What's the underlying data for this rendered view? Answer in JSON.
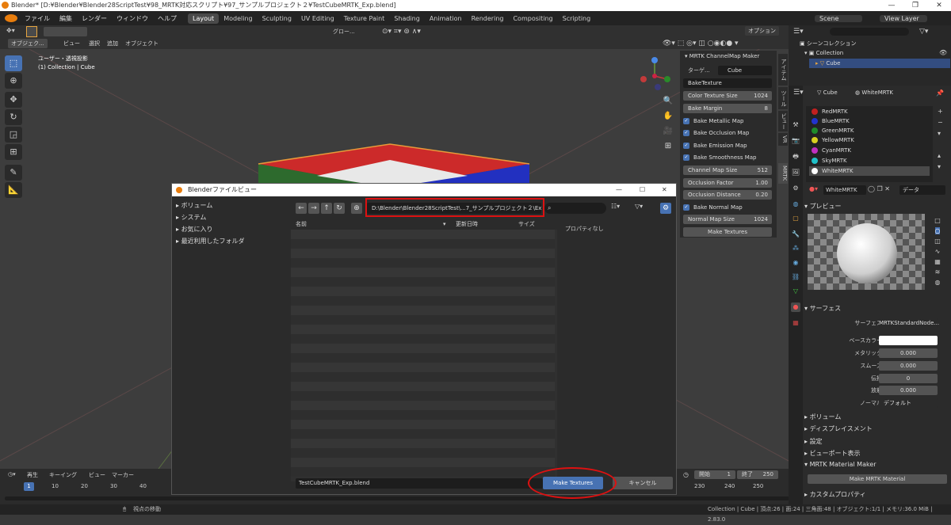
{
  "window": {
    "title": "Blender* [D:¥Blender¥Blender28ScriptTest¥98_MRTK対応スクリプト¥97_サンプルプロジェクト２¥TestCubeMRTK_Exp.blend]"
  },
  "menu": [
    "ファイル",
    "編集",
    "レンダー",
    "ウィンドウ",
    "ヘルプ"
  ],
  "workspaces": [
    "Layout",
    "Modeling",
    "Sculpting",
    "UV Editing",
    "Texture Paint",
    "Shading",
    "Animation",
    "Rendering",
    "Compositing",
    "Scripting"
  ],
  "scene": {
    "label": "Scene",
    "view_layer": "View Layer"
  },
  "viewport": {
    "orientation": "グロー...",
    "menus": [
      "オブジェク...",
      "ビュー",
      "選択",
      "追加",
      "オブジェクト"
    ],
    "view_name": "ユーザー・透視投影",
    "collection_info": "(1) Collection | Cube",
    "options": "オプション"
  },
  "npanel": {
    "title": "MRTK ChannelMap Maker",
    "target_label": "ターゲ...",
    "target_value": "Cube",
    "bake_name": "BakeTexture",
    "color_texture_size": {
      "label": "Color Texture Size",
      "value": "1024"
    },
    "bake_margin": {
      "label": "Bake Margin",
      "value": "8"
    },
    "checks": [
      "Bake Metallic Map",
      "Bake Occlusion Map",
      "Bake Emission Map",
      "Bake Smoothness Map"
    ],
    "channel_map_size": {
      "label": "Channel Map Size",
      "value": "512"
    },
    "occlusion_factor": {
      "label": "Occlusion Factor",
      "value": "1.00"
    },
    "occlusion_distance": {
      "label": "Occlusion Distance",
      "value": "0.20"
    },
    "normal_check": "Bake Normal Map",
    "normal_map_size": {
      "label": "Normal Map Size",
      "value": "1024"
    },
    "make_textures": "Make Textures",
    "tabs": [
      "アイテム",
      "ツール",
      "ビュー",
      "VR",
      "MRTK"
    ]
  },
  "outliner": {
    "scene_collection": "シーンコレクション",
    "collection": "Collection",
    "cube": "Cube"
  },
  "properties": {
    "object": "Cube",
    "material": "WhiteMRTK",
    "materials": [
      {
        "name": "RedMRTK",
        "color": "#c22020"
      },
      {
        "name": "BlueMRTK",
        "color": "#2233cc"
      },
      {
        "name": "GreenMRTK",
        "color": "#1f8a2a"
      },
      {
        "name": "YellowMRTK",
        "color": "#d8d020"
      },
      {
        "name": "CyanMRTK",
        "color": "#c030c0"
      },
      {
        "name": "SkyMRTK",
        "color": "#20c0c8"
      },
      {
        "name": "WhiteMRTK",
        "color": "#ffffff"
      }
    ],
    "material_slot": "WhiteMRTK",
    "data_label": "データ",
    "preview": "プレビュー",
    "surface_section": "サーフェス",
    "surface_label": "サーフェス",
    "surface_value": "MRTKStandardNode...",
    "fields": [
      {
        "label": "ベースカラー",
        "value": ""
      },
      {
        "label": "メタリック",
        "value": "0.000"
      },
      {
        "label": "スムーズ",
        "value": "0.000"
      },
      {
        "label": "伝播",
        "value": "0"
      },
      {
        "label": "放射",
        "value": "0.000"
      },
      {
        "label": "ノーマル",
        "value": "デフォルト"
      }
    ],
    "sections": [
      "ボリューム",
      "ディスプレイスメント",
      "設定",
      "ビューポート表示",
      "MRTK Material Maker"
    ],
    "make_material": "Make MRTK Material",
    "custom_props": "カスタムプロパティ"
  },
  "dialog": {
    "title": "Blenderファイルビュー",
    "side_items": [
      "ボリューム",
      "システム",
      "お気に入り",
      "最近利用したフォルダ"
    ],
    "path": "D:\\Blender\\Blender28ScriptTest\\...7_サンプルプロジェクト２\\Export\\",
    "columns": [
      "名前",
      "更新日時",
      "サイズ"
    ],
    "no_props": "プロパティなし",
    "filename": "TestCubeMRTK_Exp.blend",
    "ok": "Make Textures",
    "cancel": "キャンセル"
  },
  "timeline": {
    "menus": [
      "再生",
      "キーイング",
      "ビュー",
      "マーカー"
    ],
    "current": "1",
    "ticks_left": [
      "10",
      "20",
      "30",
      "40"
    ],
    "ticks_right": [
      "230",
      "240",
      "250"
    ],
    "start_label": "開始",
    "start": "1",
    "end_label": "終了",
    "end": "250"
  },
  "status": {
    "left": "視点の移動",
    "right": "Collection | Cube | 頂点:26 | 面:24 | 三角面:48 | オブジェクト:1/1 | メモリ:36.0 MiB | 2.83.0"
  }
}
